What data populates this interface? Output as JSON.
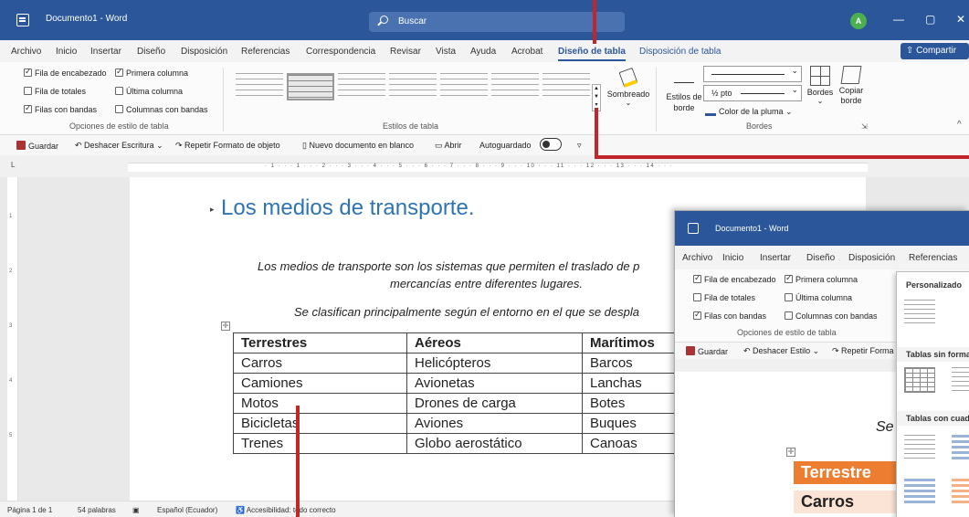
{
  "window": {
    "title": "Documento1 - Word",
    "search_placeholder": "Buscar",
    "avatar_letter": "A",
    "minimize": "—",
    "restore": "▢",
    "close": "✕"
  },
  "tabs": [
    {
      "label": "Archivo"
    },
    {
      "label": "Inicio"
    },
    {
      "label": "Insertar"
    },
    {
      "label": "Diseño"
    },
    {
      "label": "Disposición"
    },
    {
      "label": "Referencias"
    },
    {
      "label": "Correspondencia"
    },
    {
      "label": "Revisar"
    },
    {
      "label": "Vista"
    },
    {
      "label": "Ayuda"
    },
    {
      "label": "Acrobat"
    },
    {
      "label": "Diseño de tabla"
    },
    {
      "label": "Disposición de tabla"
    }
  ],
  "share_label": "Compartir",
  "table_style_options": {
    "header_row": {
      "label": "Fila de encabezado",
      "checked": true
    },
    "first_column": {
      "label": "Primera columna",
      "checked": true
    },
    "total_row": {
      "label": "Fila de totales",
      "checked": false
    },
    "last_column": {
      "label": "Última columna",
      "checked": false
    },
    "banded_rows": {
      "label": "Filas con bandas",
      "checked": true
    },
    "banded_columns": {
      "label": "Columnas con bandas",
      "checked": false
    },
    "group_label": "Opciones de estilo de tabla"
  },
  "table_styles": {
    "group_label": "Estilos de tabla"
  },
  "shading": {
    "label": "Sombreado"
  },
  "borders_group": {
    "border_styles": "Estilos de borde",
    "pen_weight": "½ pto",
    "pen_color": "Color de la pluma",
    "borders": "Bordes",
    "border_painter": "Copiar borde",
    "group_label": "Bordes"
  },
  "qat": {
    "save": "Guardar",
    "undo": "Deshacer Escritura",
    "redo": "Repetir Formato de objeto",
    "new_doc": "Nuevo documento en blanco",
    "open": "Abrir",
    "autosave": "Autoguardado"
  },
  "ruler_text": "· 1 · · · 1 · · · 2 · · · 3 · · · 4 · · · 5 · · · 6 · · · 7 · · · 8 · · · 9 · · · 10 · · · 11 · · · 12 · · · 13 · · · 14 · · ·",
  "document": {
    "heading": "Los medios de transporte.",
    "para1_line1": "Los medios de transporte son los sistemas que permiten el traslado de p",
    "para1_line2": "mercancías entre diferentes lugares.",
    "para2": "Se clasifican principalmente según el entorno en el que se despla",
    "table": {
      "headers": [
        "Terrestres",
        "Aéreos",
        "Marítimos"
      ],
      "rows": [
        [
          "Carros",
          "Helicópteros",
          "Barcos"
        ],
        [
          "Camiones",
          "Avionetas",
          "Lanchas"
        ],
        [
          "Motos",
          "Drones de carga",
          "Botes"
        ],
        [
          "Bicicletas",
          "Aviones",
          "Buques"
        ],
        [
          "Trenes",
          "Globo aerostático",
          "Canoas"
        ]
      ]
    }
  },
  "status": {
    "page": "Página 1 de 1",
    "words": "54 palabras",
    "language": "Español (Ecuador)",
    "accessibility": "Accesibilidad: todo correcto"
  },
  "inset": {
    "title": "Documento1 - Word",
    "tabs": [
      "Archivo",
      "Inicio",
      "Insertar",
      "Diseño",
      "Disposición",
      "Referencias"
    ],
    "options": {
      "header_row": "Fila de encabezado",
      "first_column": "Primera columna",
      "total_row": "Fila de totales",
      "last_column": "Última columna",
      "banded_rows": "Filas con bandas",
      "banded_columns": "Columnas con bandas",
      "group_label": "Opciones de estilo de tabla"
    },
    "qat": {
      "save": "Guardar",
      "undo": "Deshacer Estilo",
      "redo": "Repetir Forma"
    },
    "gallery": {
      "custom": "Personalizado",
      "plain": "Tablas sin forma",
      "grid": "Tablas con cuad"
    },
    "doc_text": "Se",
    "table_header": "Terrestre",
    "table_first": "Carros"
  },
  "colors": {
    "brand": "#2b579a",
    "heading": "#2e74b5",
    "annotation": "#c0262a",
    "inset_header_fill": "#ed7d31"
  }
}
